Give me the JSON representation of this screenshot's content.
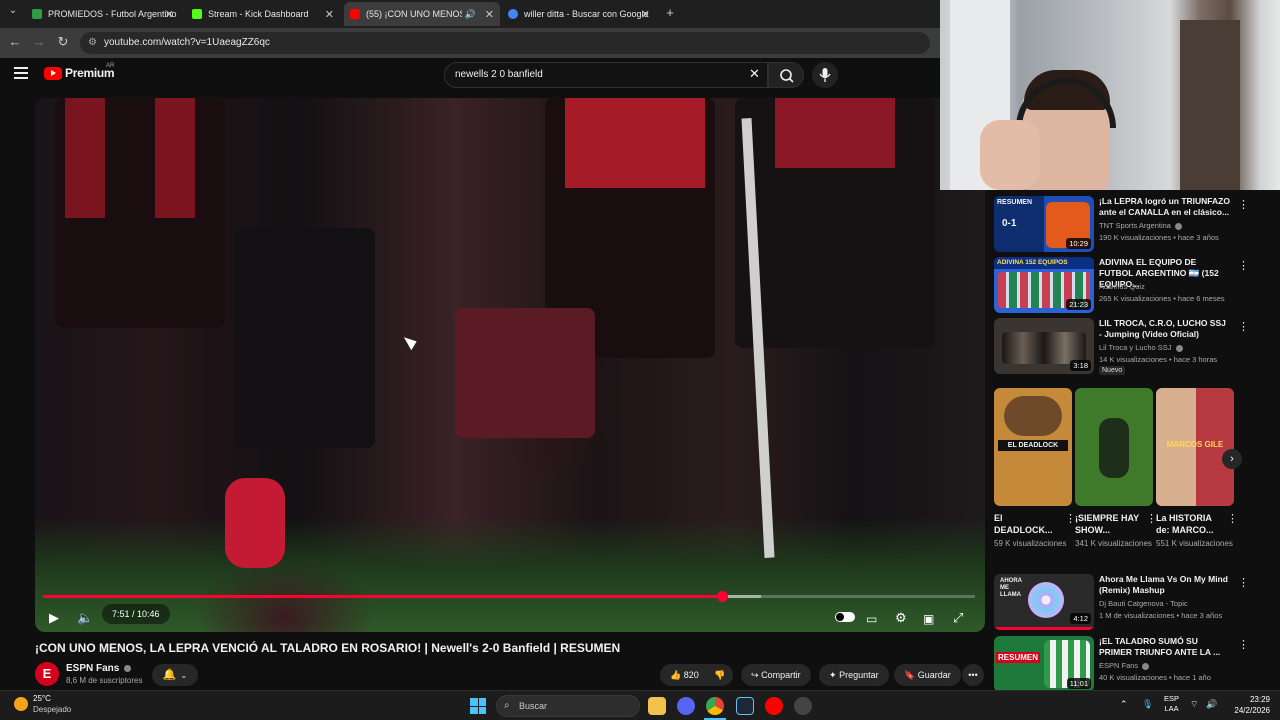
{
  "browser": {
    "tabs": [
      {
        "title": "PROMIEDOS - Futbol Argentino",
        "favicon_color": "#2e9b47",
        "active": false
      },
      {
        "title": "Stream - Kick Dashboard",
        "favicon_color": "#53fc18",
        "active": false
      },
      {
        "title": "(55) ¡CON UNO MENOS, LA",
        "favicon_color": "#ff0000",
        "active": true
      },
      {
        "title": "willer ditta - Buscar con Google",
        "favicon_color": "#4285f4",
        "active": false
      }
    ],
    "new_tab": "+",
    "url": "youtube.com/watch?v=1UaeagZZ6qc"
  },
  "youtube": {
    "logo_text": "Premium",
    "country": "AR",
    "search_query": "newells 2 0 banfield"
  },
  "video": {
    "current_time": "7:51",
    "duration": "10:46",
    "time_display": "7:51 / 10:46",
    "played_fraction": 0.729,
    "buffered_fraction": 0.77,
    "title": "¡CON UNO MENOS, LA LEPRA VENCIÓ AL TALADRO EN ROSARIO! | Newell's 2-0 Banfield | RESUMEN",
    "channel": "ESPN Fans",
    "channel_initial": "E",
    "subscribers": "8,6 M de suscriptores",
    "likes": "820",
    "share_label": "Compartir",
    "ask_label": "Preguntar",
    "save_label": "Guardar",
    "more_label": "•••"
  },
  "recommendations": [
    {
      "title": "¡La LEPRA logró un TRIUNFAZO ante el CANALLA en el clásico...",
      "channel": "TNT Sports Argentina",
      "meta": "190 K visualizaciones • hace 3 años",
      "duration": "10:29",
      "thumb_label": "RESUMEN",
      "thumb_score": "0-1",
      "thumb_color": "#1f4fb5"
    },
    {
      "title": "ADIVINA EL EQUIPO DE FUTBOL ARGENTINO 🇦🇷 (152 EQUIPO...",
      "channel": "Adivinus Quiz",
      "meta": "265 K visualizaciones • hace 6 meses",
      "duration": "21:23",
      "thumb_label": "ADIVINA 152 EQUIPOS",
      "thumb_color": "#2b63d6"
    },
    {
      "title": "LIL TROCA, C.R.O, LUCHO SSJ - Jumping (Video Oficial)",
      "channel": "Lil Troca y Lucho SSJ",
      "meta": "14 K visualizaciones • hace 3 horas",
      "duration": "3:18",
      "badge": "Nuevo",
      "thumb_color": "#3a3530"
    },
    {
      "title": "Ahora Me Llama Vs On My Mind (Remix) Mashup",
      "channel": "Dj Bauti Catgenova - Topic",
      "meta": "1 M de visualizaciones • hace 3 años",
      "duration": "4:12",
      "thumb_label": "AHORA ME LLAMA",
      "thumb_color": "#2a2a2a"
    },
    {
      "title": "¡EL TALADRO SUMÓ SU PRIMER TRIUNFO ANTE LA ...",
      "channel": "ESPN Fans",
      "meta": "40 K visualizaciones • hace 1 año",
      "duration": "11:01",
      "thumb_label": "RESUMEN",
      "thumb_color": "#1d7a3a"
    }
  ],
  "shorts": [
    {
      "title": "El DEADLOCK...",
      "views": "59 K visualizaciones",
      "thumb_text": "EL DEADLOCK",
      "thumb_color": "#c48a3a"
    },
    {
      "title": "¡SIEMPRE HAY SHOW...",
      "views": "341 K visualizaciones",
      "thumb_color": "#3f7a2a"
    },
    {
      "title": "La HISTORIA de: MARCO...",
      "views": "551 K visualizaciones",
      "thumb_text": "MARCOS GILE",
      "thumb_color": "#b63a40"
    }
  ],
  "taskbar": {
    "temperature": "25°C",
    "weather": "Despejado",
    "search_placeholder": "Buscar",
    "language": "ESP",
    "language_sub": "LAA",
    "time": "23:29",
    "date": "24/2/2026"
  },
  "colors": {
    "youtube_red": "#ff0000",
    "progress_red": "#ff0033",
    "background": "#0f0f0f"
  }
}
